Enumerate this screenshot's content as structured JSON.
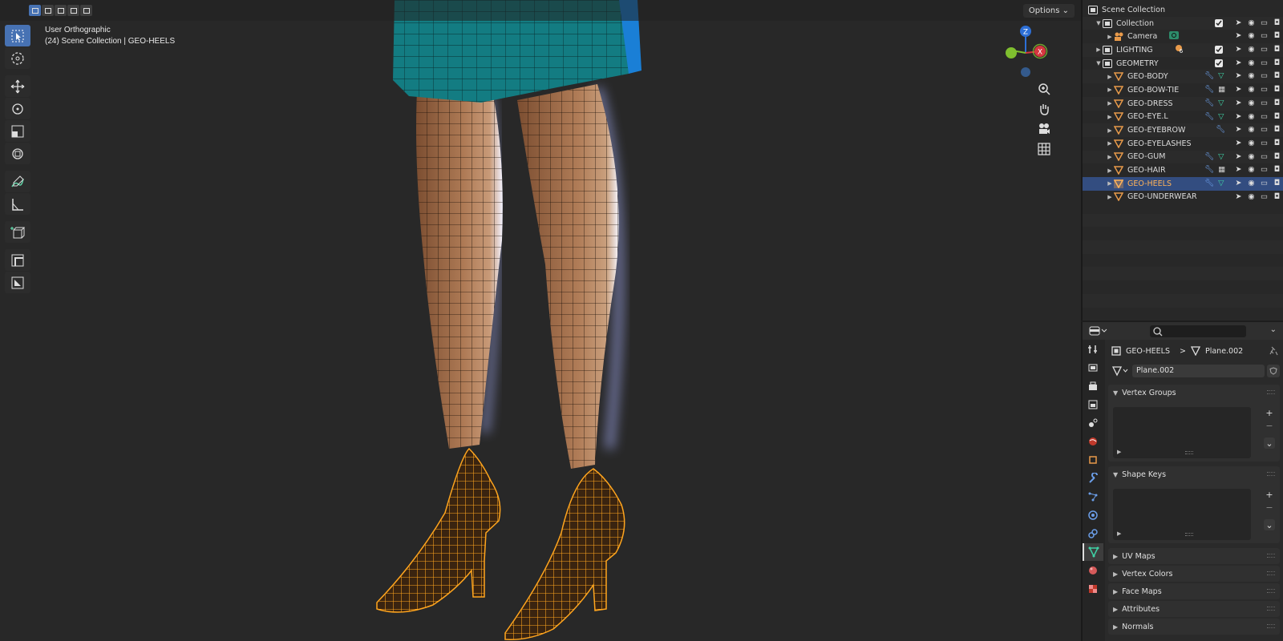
{
  "header": {
    "options_label": "Options",
    "options_chevron": "⌄"
  },
  "view_info": {
    "line1": "User Orthographic",
    "line2": "(24) Scene Collection | GEO-HEELS"
  },
  "toolbar": {
    "tools": [
      "select-box-icon",
      "cursor-icon",
      "move-icon",
      "rotate-icon",
      "scale-icon",
      "transform-icon",
      "annotate-icon",
      "measure-icon",
      "add-cube-icon",
      "extrude-icon",
      "inset-icon"
    ]
  },
  "gizmo": {
    "z_label": "Z",
    "x_label": "X",
    "y_label": "Y"
  },
  "outliner": {
    "scene_collection": "Scene Collection",
    "rows": [
      {
        "name": "Collection",
        "level": 1,
        "type": "collection"
      },
      {
        "name": "Camera",
        "level": 2,
        "type": "camera"
      },
      {
        "name": "LIGHTING",
        "level": 1,
        "type": "collection"
      },
      {
        "name": "GEOMETRY",
        "level": 1,
        "type": "collection"
      },
      {
        "name": "GEO-BODY",
        "level": 2,
        "type": "mesh"
      },
      {
        "name": "GEO-BOW-TIE",
        "level": 2,
        "type": "mesh"
      },
      {
        "name": "GEO-DRESS",
        "level": 2,
        "type": "mesh"
      },
      {
        "name": "GEO-EYE.L",
        "level": 2,
        "type": "mesh"
      },
      {
        "name": "GEO-EYEBROW",
        "level": 2,
        "type": "mesh"
      },
      {
        "name": "GEO-EYELASHES",
        "level": 2,
        "type": "mesh"
      },
      {
        "name": "GEO-GUM",
        "level": 2,
        "type": "mesh"
      },
      {
        "name": "GEO-HAIR",
        "level": 2,
        "type": "mesh"
      },
      {
        "name": "GEO-HEELS",
        "level": 2,
        "type": "mesh",
        "selected": true
      },
      {
        "name": "GEO-UNDERWEAR",
        "level": 2,
        "type": "mesh"
      }
    ],
    "lighting_badge": "6"
  },
  "properties": {
    "breadcrumb_object": "GEO-HEELS",
    "breadcrumb_sep": ">",
    "breadcrumb_mesh": "Plane.002",
    "mesh_name": "Plane.002",
    "panels": {
      "vertex_groups": "Vertex Groups",
      "shape_keys": "Shape Keys",
      "uv_maps": "UV Maps",
      "vertex_colors": "Vertex Colors",
      "face_maps": "Face Maps",
      "attributes": "Attributes",
      "normals": "Normals"
    },
    "add_symbol": "+",
    "remove_symbol": "−",
    "menu_symbol": "⌄"
  },
  "colors": {
    "accent": "#4772b3",
    "selected_text": "#ffb35a",
    "dress": "#137c82",
    "skin": "#a2704d",
    "heel_wire": "#ffa51e"
  }
}
